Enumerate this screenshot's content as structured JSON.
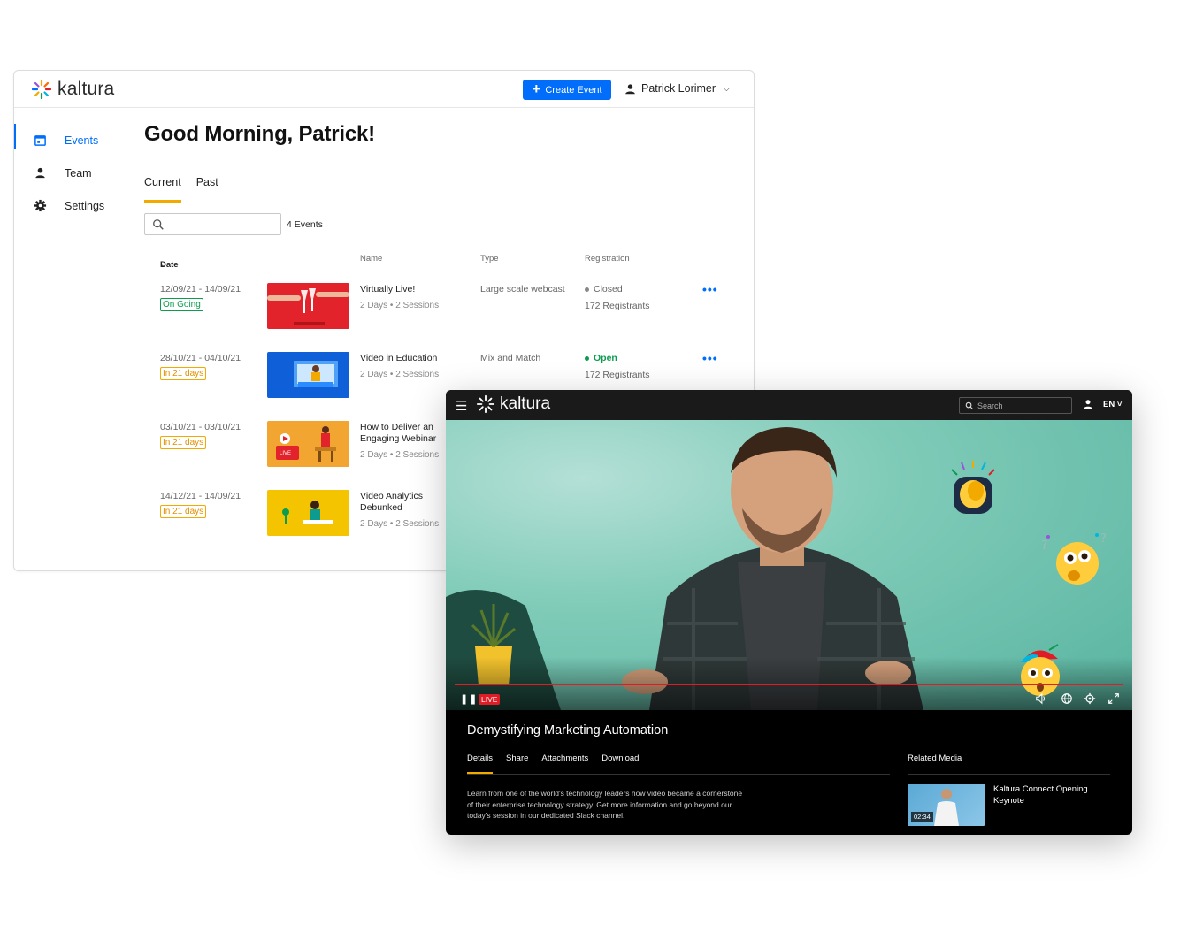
{
  "admin": {
    "brand": "kaltura",
    "create_button": "Create Event",
    "user_name": "Patrick Lorimer",
    "sidebar": [
      {
        "label": "Events",
        "icon": "calendar-icon",
        "active": true
      },
      {
        "label": "Team",
        "icon": "person-icon",
        "active": false
      },
      {
        "label": "Settings",
        "icon": "gear-icon",
        "active": false
      }
    ],
    "greeting": "Good Morning, Patrick!",
    "tabs": [
      {
        "label": "Current",
        "active": true
      },
      {
        "label": "Past",
        "active": false
      }
    ],
    "event_count": "4 Events",
    "columns": {
      "date": "Date",
      "name": "Name",
      "type": "Type",
      "registration": "Registration"
    },
    "events": [
      {
        "date": "12/09/21 - 14/09/21",
        "badge": "On Going",
        "badge_color": "green",
        "name": "Virtually Live!",
        "duration": "2 Days",
        "sessions": "2 Sessions",
        "type": "Large scale webcast",
        "status": "Closed",
        "registrants": "172 Registrants"
      },
      {
        "date": "28/10/21 - 04/10/21",
        "badge": "In 21 days",
        "badge_color": "orange",
        "name": "Video in Education",
        "duration": "2 Days",
        "sessions": "2 Sessions",
        "type": "Mix and Match",
        "status": "Open",
        "registrants": "172 Registrants"
      },
      {
        "date": "03/10/21 - 03/10/21",
        "badge": "In 21 days",
        "badge_color": "orange",
        "name": "How to Deliver an Engaging Webinar",
        "duration": "2 Days",
        "sessions": "2 Sessions"
      },
      {
        "date": "14/12/21 - 14/09/21",
        "badge": "In 21 days",
        "badge_color": "orange",
        "name": "Video Analytics Debunked",
        "duration": "2 Days",
        "sessions": "2 Sessions"
      }
    ],
    "colors": {
      "accent": "#006efa",
      "tab_underline": "#f2a900",
      "open": "#0d9b4f"
    }
  },
  "player": {
    "brand": "kaltura",
    "search_placeholder": "Search",
    "language": "EN",
    "live_label": "LIVE",
    "title": "Demystifying Marketing Automation",
    "tabs": [
      {
        "label": "Details",
        "active": true
      },
      {
        "label": "Share",
        "active": false
      },
      {
        "label": "Attachments",
        "active": false
      },
      {
        "label": "Download",
        "active": false
      }
    ],
    "description": "Learn from one of the world's technology leaders how video became a cornerstone of their enterprise technology strategy. Get more information and go beyond our today's session in our dedicated Slack channel.",
    "related_title": "Related Media",
    "related": [
      {
        "title": "Kaltura Connect Opening Keynote",
        "duration": "02:34"
      }
    ],
    "colors": {
      "live": "#e01c26"
    }
  }
}
